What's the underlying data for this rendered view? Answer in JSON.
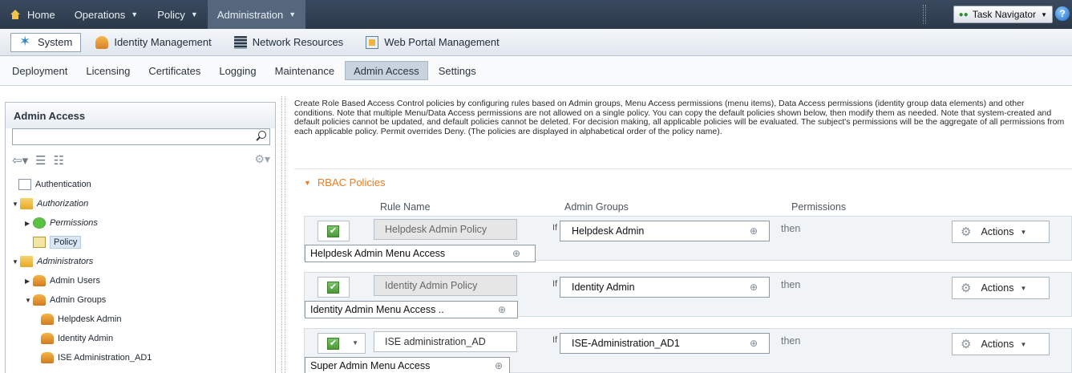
{
  "top_nav": {
    "items": [
      {
        "label": "Home",
        "icon": "home-icon",
        "caret": false
      },
      {
        "label": "Operations",
        "caret": true
      },
      {
        "label": "Policy",
        "caret": true
      },
      {
        "label": "Administration",
        "caret": true,
        "active": true
      }
    ],
    "task_navigator": "Task Navigator",
    "help_icon": "help-icon"
  },
  "sub_nav": {
    "items": [
      {
        "label": "System",
        "icon": "system-icon",
        "selected": true
      },
      {
        "label": "Identity Management",
        "icon": "identity-management-icon"
      },
      {
        "label": "Network Resources",
        "icon": "network-resources-icon"
      },
      {
        "label": "Web Portal Management",
        "icon": "web-portal-icon"
      }
    ]
  },
  "tab_nav": {
    "tabs": [
      "Deployment",
      "Licensing",
      "Certificates",
      "Logging",
      "Maintenance",
      "Admin Access",
      "Settings"
    ],
    "active_tab": "Admin Access"
  },
  "left_panel": {
    "title": "Admin Access",
    "search": {
      "value": "",
      "placeholder": ""
    },
    "tree": [
      {
        "label": "Authentication",
        "icon": "document-icon"
      },
      {
        "label": "Authorization",
        "icon": "folder-icon"
      },
      {
        "label": "Permissions",
        "icon": "check-circle-icon"
      },
      {
        "label": "Policy",
        "icon": "policy-icon"
      },
      {
        "label": "Administrators",
        "icon": "folder-icon"
      },
      {
        "label": "Admin Users",
        "icon": "users-icon"
      },
      {
        "label": "Admin Groups",
        "icon": "users-icon"
      },
      {
        "label": "Helpdesk Admin",
        "icon": "users-icon"
      },
      {
        "label": "Identity Admin",
        "icon": "users-icon"
      },
      {
        "label": "ISE Administration_AD1",
        "icon": "users-icon"
      }
    ]
  },
  "main": {
    "description": "Create Role Based Access Control policies by configuring rules based on Admin groups, Menu Access permissions (menu items), Data Access permissions (identity group data elements) and other conditions. Note that multiple Menu/Data Access permissions are not allowed on a single policy. You can copy the default policies shown below, then modify them as needed. Note that system-created and default policies cannot be updated, and default policies cannot be deleted. For decision making, all applicable policies will be evaluated. The subject's permissions will be the aggregate of all permissions from each applicable policy. Permit overrides Deny. (The policies are displayed in alphabetical order of the policy name).",
    "rbac_title": "RBAC Policies",
    "columns": {
      "rule_name": "Rule Name",
      "admin_groups": "Admin Groups",
      "permissions": "Permissions"
    },
    "if_label": "If",
    "then_label": "then",
    "actions_label": "Actions",
    "rows": [
      {
        "rule_name": "Helpdesk Admin Policy",
        "admin_group": "Helpdesk Admin",
        "permission": "Helpdesk Admin Menu Access",
        "enabled": true
      },
      {
        "rule_name": "Identity Admin Policy",
        "admin_group": "Identity Admin",
        "permission": "Identity Admin Menu Access ..",
        "enabled": true
      },
      {
        "rule_name": "ISE administration_AD",
        "admin_group": "ISE-Administration_AD1",
        "permission": "Super Admin Menu Access",
        "enabled": true
      }
    ]
  }
}
